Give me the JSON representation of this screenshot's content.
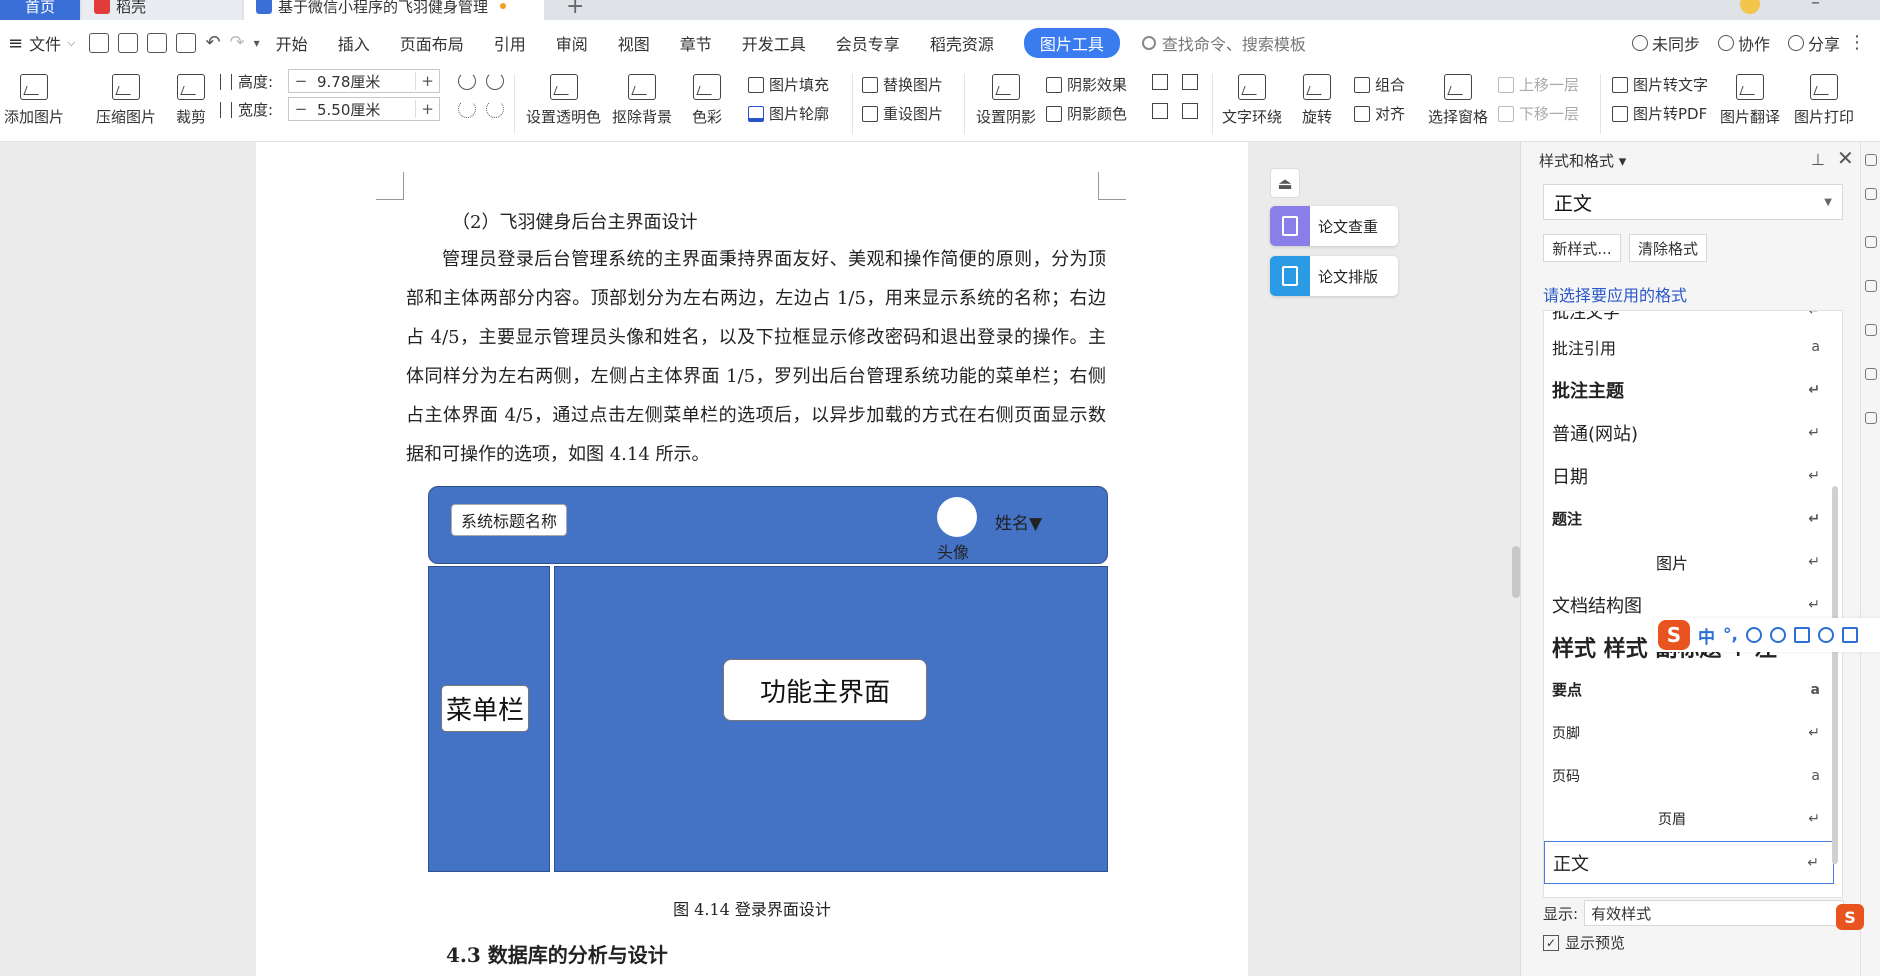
{
  "tabs": {
    "home": "首页",
    "docer": "稻壳",
    "document": "基于微信小程序的飞羽健身管理"
  },
  "menu": {
    "file": "文件",
    "items": [
      "开始",
      "插入",
      "页面布局",
      "引用",
      "审阅",
      "视图",
      "章节",
      "开发工具",
      "会员专享",
      "稻壳资源"
    ],
    "active": "图片工具",
    "search_placeholder": "查找命令、搜索模板",
    "right": [
      "未同步",
      "协作",
      "分享"
    ]
  },
  "ribbon": {
    "add_picture": "添加图片",
    "compress": "压缩图片",
    "crop": "裁剪",
    "height_label": "高度:",
    "height_value": "9.78厘米",
    "width_label": "宽度:",
    "width_value": "5.50厘米",
    "transparent": "设置透明色",
    "remove_bg": "抠除背景",
    "color": "色彩",
    "fill": "图片填充",
    "outline": "图片轮廓",
    "replace": "替换图片",
    "reset": "重设图片",
    "shadow": "设置阴影",
    "shadow_effect": "阴影效果",
    "shadow_color": "阴影颜色",
    "wrap": "文字环绕",
    "rotate": "旋转",
    "group": "组合",
    "align": "对齐",
    "selection": "选择窗格",
    "bring_forward": "上移一层",
    "send_backward": "下移一层",
    "to_text": "图片转文字",
    "to_pdf": "图片转PDF",
    "translate": "图片翻译",
    "print": "图片打印"
  },
  "document": {
    "subheading": "（2）飞羽健身后台主界面设计",
    "paragraph": "管理员登录后台管理系统的主界面秉持界面友好、美观和操作简便的原则，分为顶部和主体两部分内容。顶部划分为左右两边，左边占 1/5，用来显示系统的名称；右边占 4/5，主要显示管理员头像和姓名，以及下拉框显示修改密码和退出登录的操作。主体同样分为左右两侧，左侧占主体界面 1/5，罗列出后台管理系统功能的菜单栏；右侧占主体界面 4/5，通过点击左侧菜单栏的选项后，以异步加载的方式在右侧页面显示数据和可操作的选项，如图 4.14 所示。",
    "diagram": {
      "title_box": "系统标题名称",
      "avatar_label": "头像",
      "name": "姓名▼",
      "menu_bar": "菜单栏",
      "main_area": "功能主界面"
    },
    "caption": "图 4.14  登录界面设计",
    "section_heading": "4.3    数据库的分析与设计"
  },
  "float_buttons": {
    "check": "论文查重",
    "format": "论文排版"
  },
  "panel": {
    "title": "样式和格式",
    "current_style": "正文",
    "new_style": "新样式...",
    "clear_format": "清除格式",
    "subtitle": "请选择要应用的格式",
    "styles": [
      {
        "label": "批注文字",
        "mark": "↵"
      },
      {
        "label": "批注引用",
        "mark": "a"
      },
      {
        "label": "批注主题",
        "mark": "↵"
      },
      {
        "label": "普通(网站)",
        "mark": "↵"
      },
      {
        "label": "日期",
        "mark": "↵"
      },
      {
        "label": "题注",
        "mark": "↵"
      },
      {
        "label": "图片",
        "mark": "↵"
      },
      {
        "label": "文档结构图",
        "mark": "↵"
      },
      {
        "label": "样式 样式 副标题 + 左",
        "mark": "↵"
      },
      {
        "label": "要点",
        "mark": "a"
      },
      {
        "label": "页脚",
        "mark": "↵"
      },
      {
        "label": "页码",
        "mark": "a"
      },
      {
        "label": "页眉",
        "mark": "↵"
      },
      {
        "label": "正文",
        "mark": "↵"
      }
    ],
    "show_label": "显示:",
    "show_value": "有效样式",
    "preview_label": "显示预览"
  },
  "ime": {
    "logo": "S",
    "mode": "中"
  },
  "colors": {
    "accent": "#3b7bf0",
    "diagram_blue": "#4472c4",
    "panel_link": "#2b58c8"
  }
}
